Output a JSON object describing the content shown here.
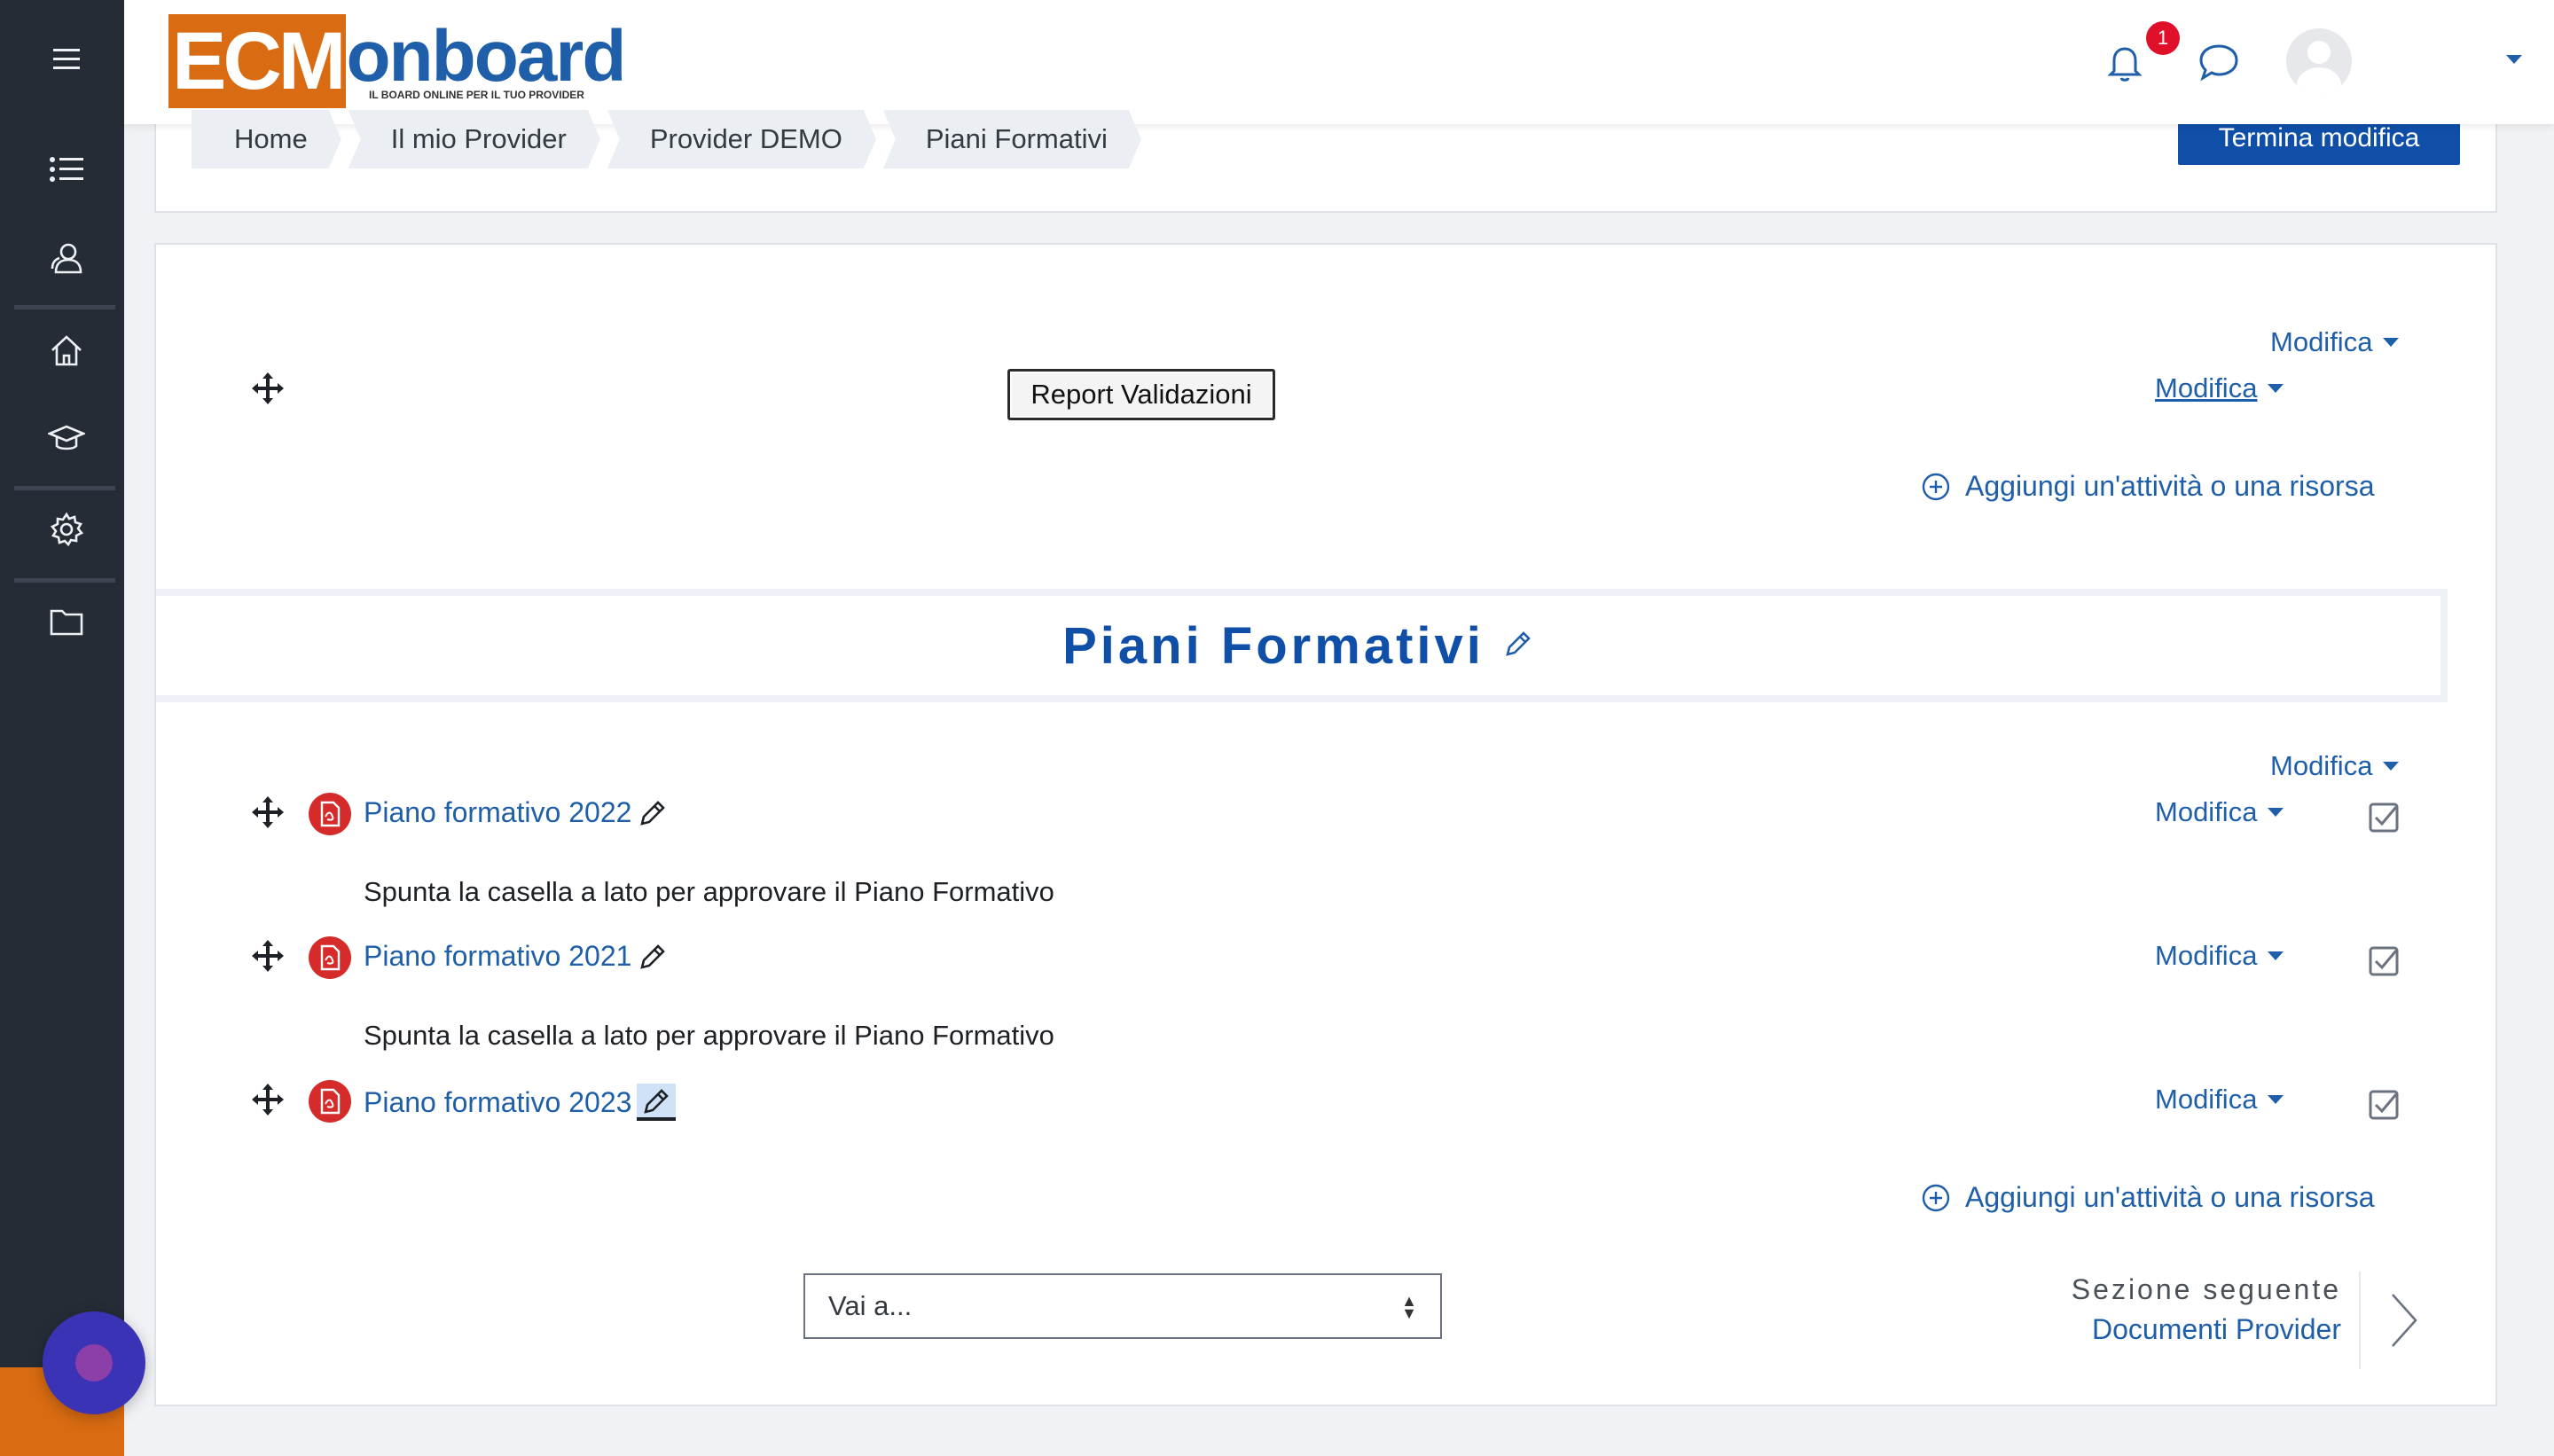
{
  "header": {
    "logo_ecm": "ECM",
    "logo_onboard": "onboard",
    "logo_tagline": "IL BOARD ONLINE PER IL TUO PROVIDER",
    "notification_count": "1",
    "icons": [
      "bell-icon",
      "chat-icon",
      "user-avatar"
    ]
  },
  "sidebar": {
    "items": [
      "menu-icon",
      "list-icon",
      "participants-icon",
      "home-icon",
      "graduation-cap-icon",
      "gear-icon",
      "folder-icon"
    ]
  },
  "breadcrumb": {
    "items": [
      "Home",
      "Il mio Provider",
      "Provider DEMO",
      "Piani Formativi"
    ]
  },
  "toolbar": {
    "end_edit_label": "Termina modifica"
  },
  "section_top": {
    "edit_label": "Modifica",
    "edit_label_2": "Modifica",
    "report_button_label": "Report Validazioni",
    "add_label": "Aggiungi un'attività o una risorsa"
  },
  "section": {
    "title": "Piani Formativi",
    "edit_label": "Modifica",
    "activities": [
      {
        "name": "Piano formativo 2022",
        "edit_label": "Modifica",
        "description": "Spunta la casella a lato per approvare il Piano Formativo"
      },
      {
        "name": "Piano formativo 2021",
        "edit_label": "Modifica",
        "description": "Spunta la casella a lato per approvare il Piano Formativo"
      },
      {
        "name": "Piano formativo 2023",
        "edit_label": "Modifica",
        "description": ""
      }
    ],
    "add_label": "Aggiungi un'attività o una risorsa"
  },
  "navigation": {
    "jump_placeholder": "Vai a...",
    "next_label": "Sezione seguente",
    "next_title": "Documenti Provider"
  },
  "colors": {
    "brand_orange": "#d96b12",
    "brand_blue": "#0f4fa8",
    "rail": "#262c36"
  }
}
